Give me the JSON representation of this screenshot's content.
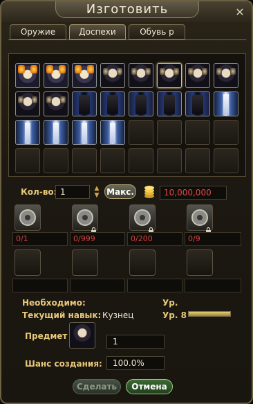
{
  "window": {
    "title": "Изготовить",
    "close_glyph": "✕"
  },
  "tabs": [
    {
      "label": "Оружие",
      "active": false
    },
    {
      "label": "Доспехи",
      "active": true
    },
    {
      "label": "Обувь р",
      "active": false
    }
  ],
  "grid": {
    "rows": 4,
    "cols": 8,
    "items": [
      "gold",
      "gold",
      "gold",
      "dark",
      "dark",
      "dark",
      "dark",
      "dark",
      "dark",
      "dark",
      "pants",
      "pants",
      "pants",
      "pants",
      "pants",
      "robe",
      "robe",
      "robe",
      "robe",
      "robe"
    ],
    "selected_index": 5
  },
  "quantity": {
    "label": "Кол-во:",
    "value": "1",
    "max_label": "Макс.",
    "cost": "10,000,000"
  },
  "materials": [
    {
      "count": "0/1",
      "icon": "ore-icon",
      "locked": false
    },
    {
      "count": "0/999",
      "icon": "coin-material-icon",
      "locked": true
    },
    {
      "count": "0/200",
      "icon": "gear-material-icon",
      "locked": true
    },
    {
      "count": "0/9",
      "icon": "ingot-icon",
      "locked": true
    }
  ],
  "requirements": {
    "needed_label": "Необходимо:",
    "level_label": "Ур.",
    "skill_label": "Текущий навык:",
    "skill_value": "Кузнец",
    "skill_level": "Ур. 8",
    "skill_progress": 1.0
  },
  "product": {
    "label": "Предмет",
    "quantity": "1"
  },
  "chance": {
    "label": "Шанс создания:",
    "value": "100.0%"
  },
  "buttons": {
    "craft": "Сделать",
    "cancel": "Отмена"
  },
  "colors": {
    "gold_label": "#e8c87a",
    "cost_red": "#e04848",
    "cancel_green": "#3c6a34"
  }
}
